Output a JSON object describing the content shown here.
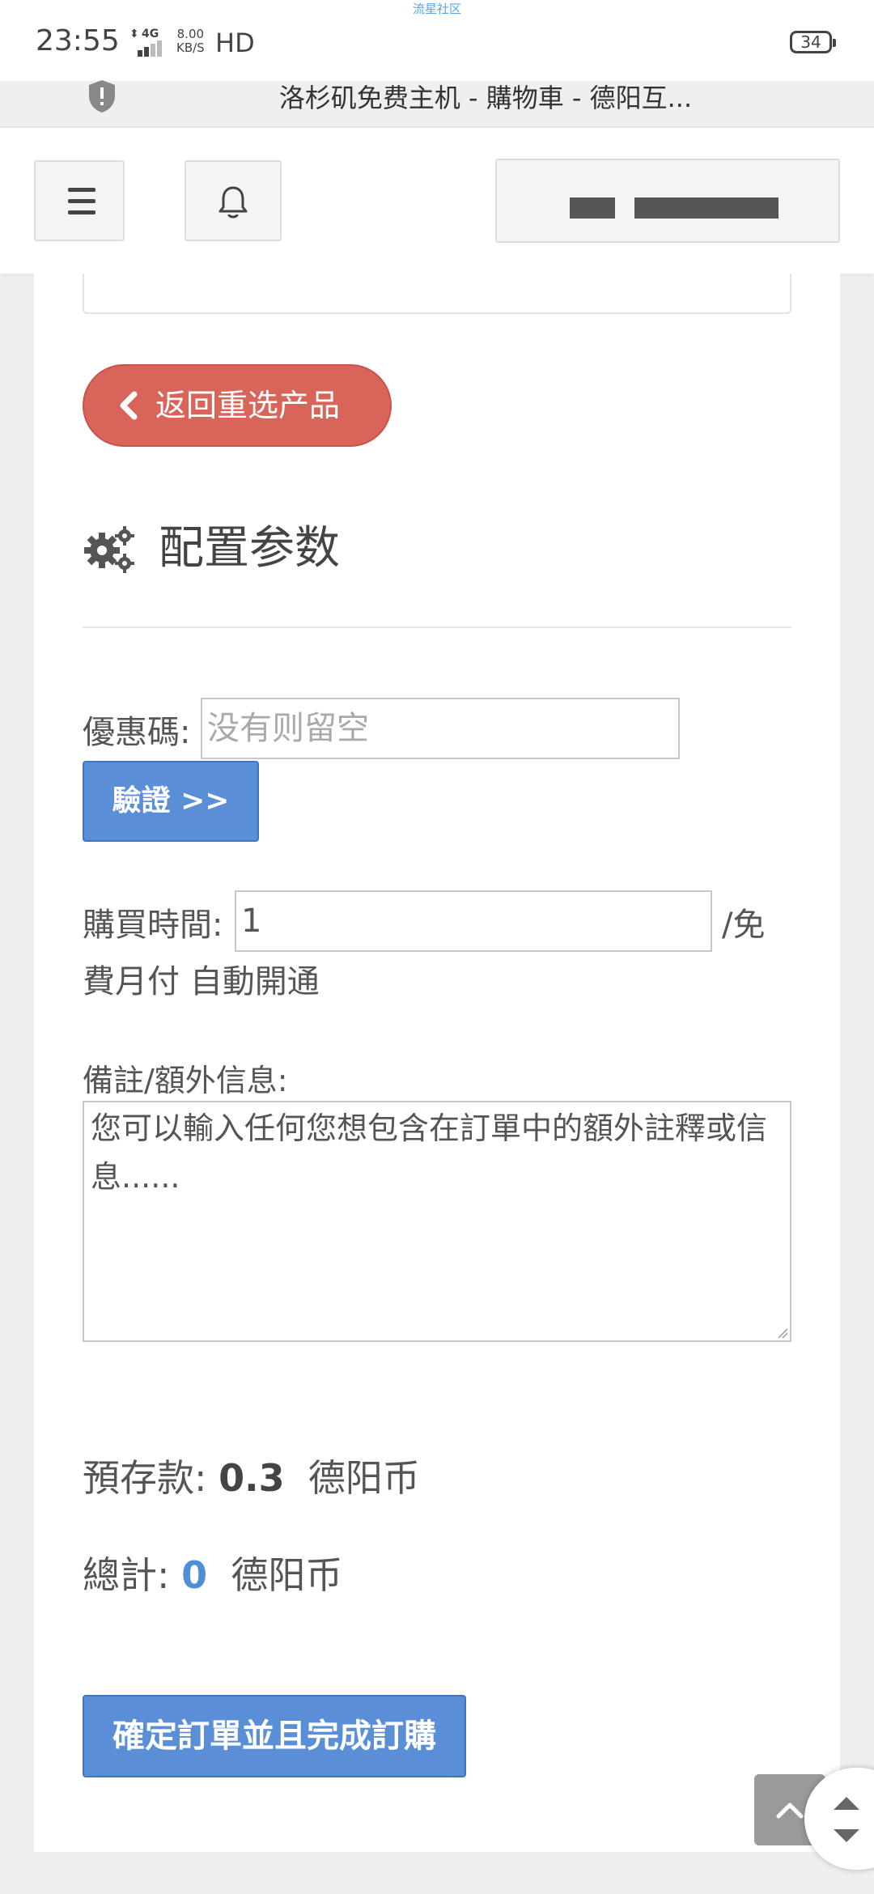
{
  "status_bar": {
    "watermark": "流星社区",
    "time": "23:55",
    "network": "4G",
    "speed_value": "8.00",
    "speed_unit": "KB/S",
    "hd": "HD",
    "battery": "34"
  },
  "browser": {
    "title": "洛杉矶免费主机 - 購物車 - 德阳互..."
  },
  "order_form": {
    "back_button": "返回重选产品",
    "section_title": "配置参数",
    "coupon_label": "優惠碼:",
    "coupon_placeholder": "没有则留空",
    "verify_button": "驗證 >>",
    "duration_label": "購買時間:",
    "duration_value": "1",
    "duration_suffix_1": "/免",
    "duration_suffix_2": "費月付 自動開通",
    "notes_label": "備註/額外信息:",
    "notes_placeholder": "您可以輸入任何您想包含在訂單中的額外註釋或信息......",
    "balance_label": "預存款:",
    "balance_value": "0.3",
    "balance_unit": "德阳币",
    "total_label": "總計:",
    "total_value": "0",
    "total_unit": "德阳币",
    "submit_button": "確定訂單並且完成訂購"
  },
  "colors": {
    "back_button": "#d9645a",
    "primary_button": "#5a8fd8",
    "total_value": "#4f8fd6"
  }
}
